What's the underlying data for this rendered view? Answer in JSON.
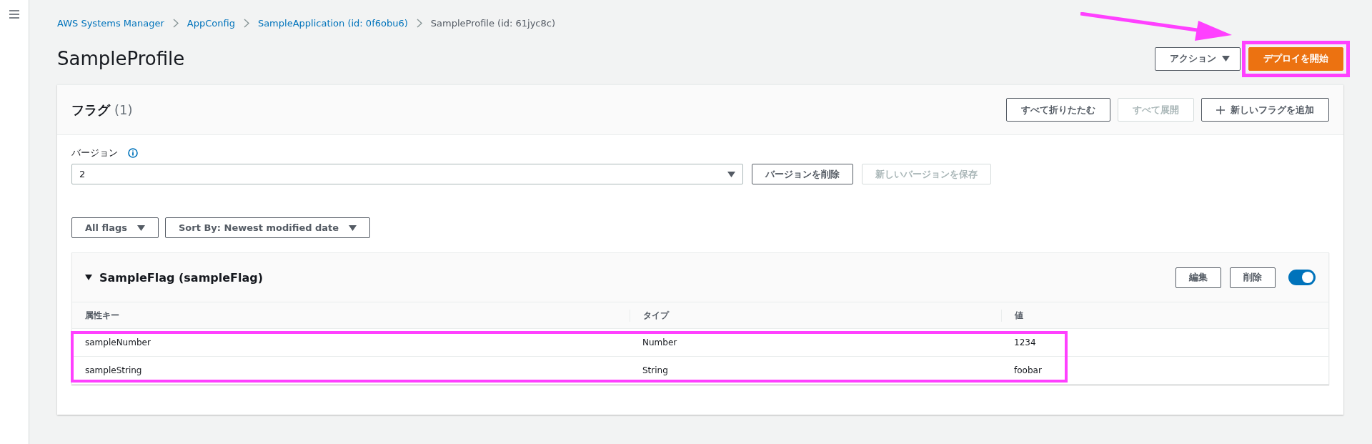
{
  "breadcrumbs": [
    {
      "label": "AWS Systems Manager",
      "link": true
    },
    {
      "label": "AppConfig",
      "link": true
    },
    {
      "label": "SampleApplication (id: 0f6obu6)",
      "link": true
    },
    {
      "label": "SampleProfile (id: 61jyc8c)",
      "link": false
    }
  ],
  "title": "SampleProfile",
  "header_actions": [
    {
      "label": "アクション",
      "kind": "dropdown",
      "highlighted": false
    },
    {
      "label": "デプロイを開始",
      "kind": "primary",
      "highlighted": true
    }
  ],
  "flags_panel": {
    "title": "フラグ",
    "count": "(1)",
    "buttons": [
      {
        "label": "すべて折りたたむ",
        "disabled": false,
        "kind": "plain"
      },
      {
        "label": "すべて展開",
        "disabled": true,
        "kind": "plain"
      },
      {
        "label": "新しいフラグを追加",
        "disabled": false,
        "kind": "add"
      }
    ],
    "version": {
      "label": "バージョン",
      "value": "2"
    },
    "version_buttons": [
      {
        "label": "バージョンを削除",
        "disabled": false
      },
      {
        "label": "新しいバージョンを保存",
        "disabled": true
      }
    ],
    "filters": [
      "All flags",
      "Sort By: Newest modified date"
    ],
    "flags": [
      {
        "title": "SampleFlag (sampleFlag)",
        "expanded": true,
        "enabled": true,
        "buttons": [
          "編集",
          "削除"
        ],
        "columns": [
          "属性キー",
          "タイプ",
          "値"
        ],
        "rows_highlighted": true,
        "rows": [
          [
            "sampleNumber",
            "Number",
            "1234"
          ],
          [
            "sampleString",
            "String",
            "foobar"
          ]
        ]
      }
    ]
  }
}
